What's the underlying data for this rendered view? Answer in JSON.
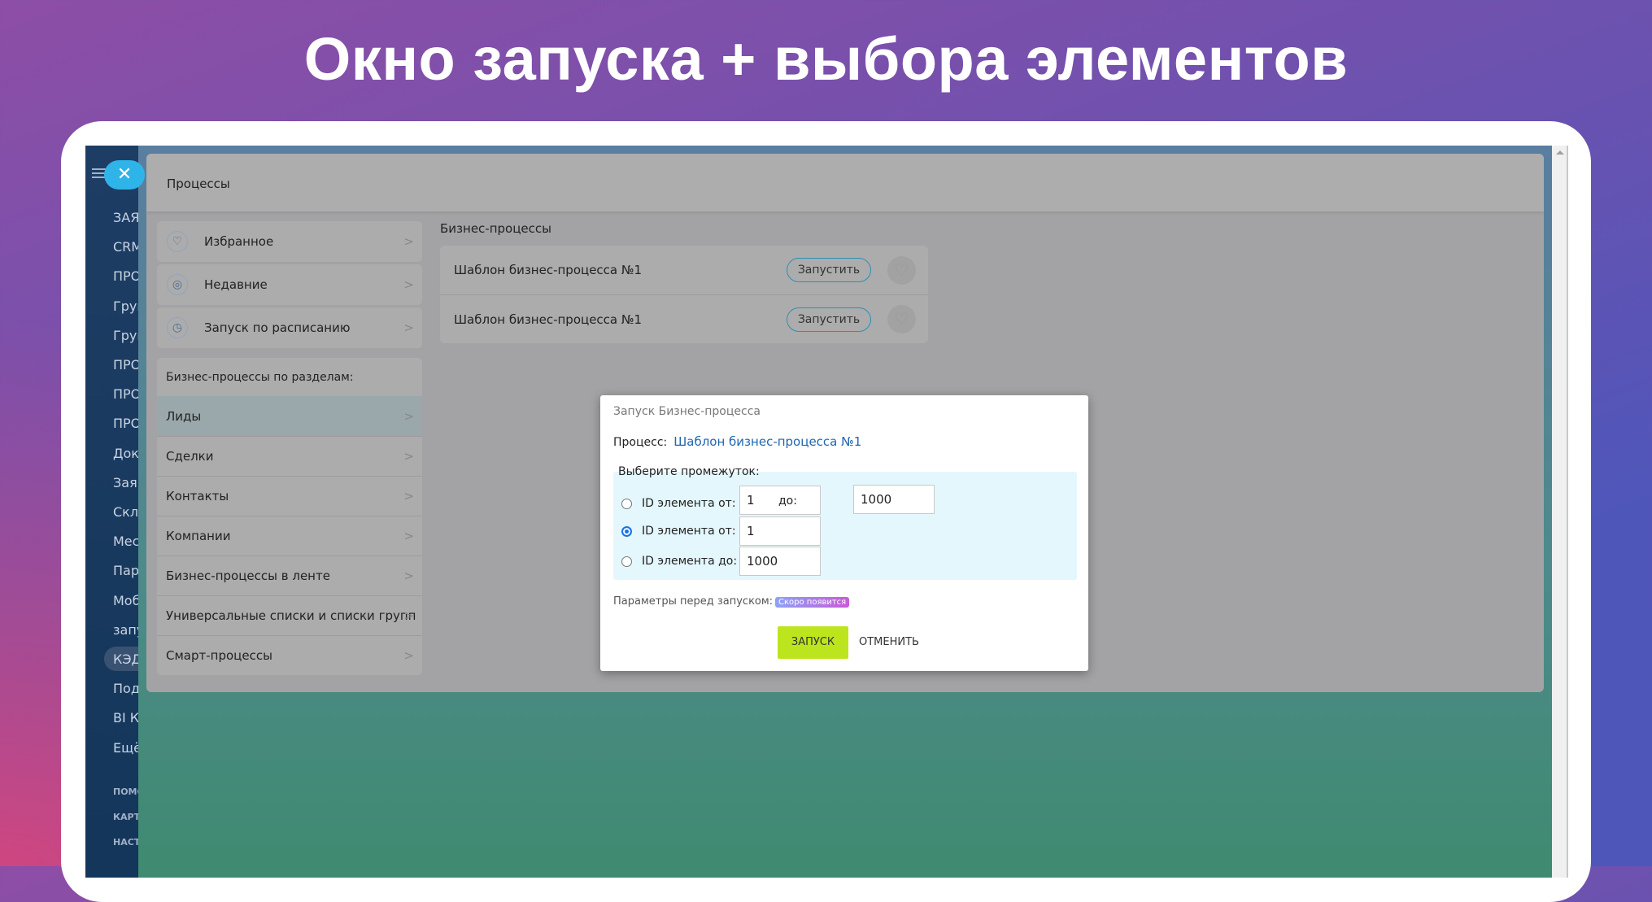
{
  "headline": "Окно запуска + выбора элементов",
  "sidebar": {
    "items": [
      "ЗАЯВКИ",
      "CRM",
      "ПРОЕКТЫ",
      "Группы",
      "Группы",
      "ПРОЦЕССЫ",
      "ПРОДАЖИ",
      "ПРОФИЛЬ",
      "Документы",
      "Заявки",
      "Склад",
      "Мессенджер",
      "Пароли",
      "Мобильное",
      "запуск",
      "КЭДО",
      "Подписка",
      "BI Конструктор",
      "Ещё"
    ],
    "small": [
      "ПОМОЩЬ",
      "КАРТА",
      "НАСТРОЙКИ"
    ]
  },
  "panel": {
    "title": "Процессы",
    "menu": [
      {
        "label": "Избранное",
        "icon": "heart-icon"
      },
      {
        "label": "Недавние",
        "icon": "recent-icon"
      },
      {
        "label": "Запуск по расписанию",
        "icon": "clock-icon"
      }
    ],
    "sections_header": "Бизнес-процессы по разделам:",
    "sections": [
      "Лиды",
      "Сделки",
      "Контакты",
      "Компании",
      "Бизнес-процессы в ленте",
      "Универсальные списки и списки групп",
      "Смарт-процессы"
    ],
    "list_label": "Бизнес-процессы",
    "processes": [
      {
        "name": "Шаблон бизнес-процесса №1",
        "button": "Запустить"
      },
      {
        "name": "Шаблон бизнес-процесса №1",
        "button": "Запустить"
      }
    ]
  },
  "modal": {
    "title": "Запуск Бизнес-процесса",
    "process_label": "Процесс:",
    "process_name": "Шаблон бизнес-процесса №1",
    "range_label": "Выберите промежуток:",
    "options": [
      {
        "label": "ID элемента от:",
        "value": "1",
        "to_label": "до:",
        "to_value": "1000",
        "checked": false
      },
      {
        "label": "ID элемента от:",
        "value": "1",
        "checked": true
      },
      {
        "label": "ID элемента до:",
        "value": "1000",
        "checked": false
      }
    ],
    "params_label": "Параметры перед запуском:",
    "badge": "Скоро появится",
    "start": "ЗАПУСК",
    "cancel": "ОТМЕНИТЬ"
  }
}
